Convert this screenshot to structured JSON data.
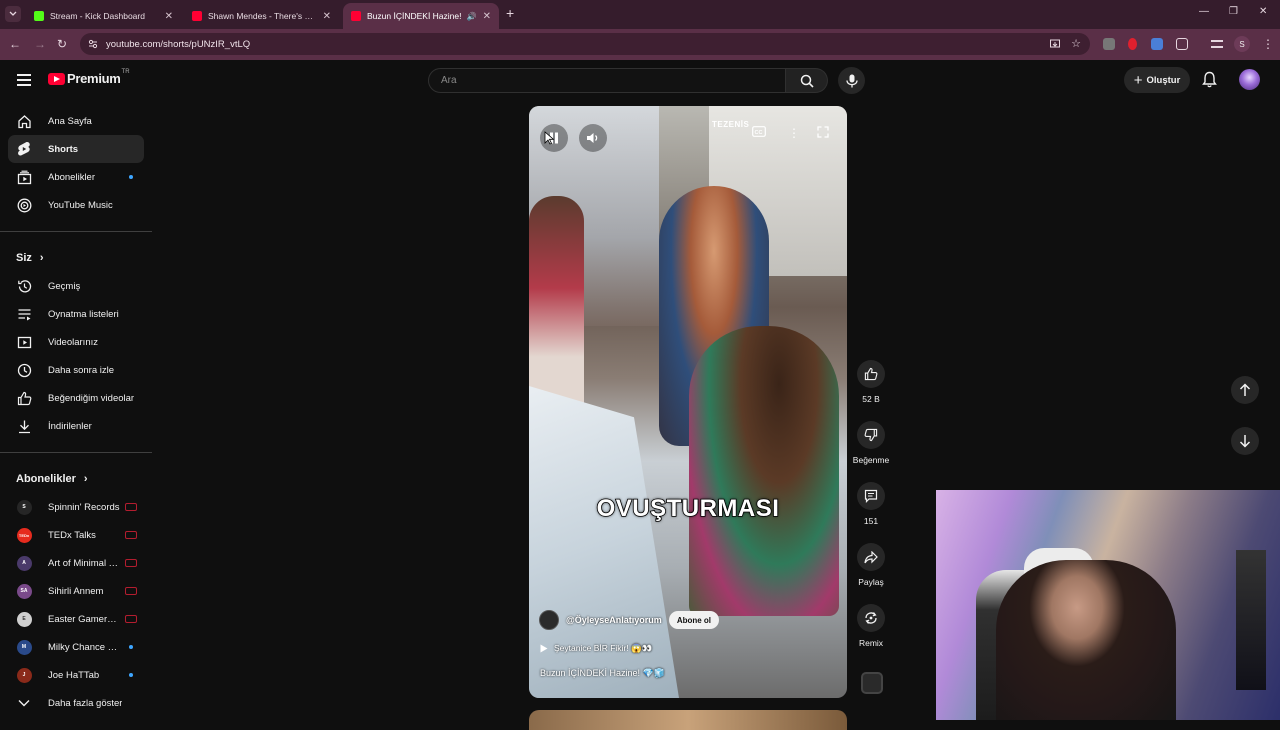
{
  "browser": {
    "tabs": [
      {
        "title": "Stream - Kick Dashboard",
        "favicon_color": "#53fc18",
        "active": false
      },
      {
        "title": "Shawn Mendes - There's Nothing",
        "favicon_color": "#ff0033",
        "active": false
      },
      {
        "title": "Buzun İÇİNDEKİ Hazine!",
        "favicon_color": "#ff0033",
        "active": true
      }
    ],
    "url": "youtube.com/shorts/pUNzIR_vtLQ",
    "profile_initial": "S"
  },
  "header": {
    "brand": "Premium",
    "country": "TR",
    "search_placeholder": "Ara",
    "create_label": "Oluştur"
  },
  "sidebar": {
    "main": [
      {
        "label": "Ana Sayfa",
        "icon": "home-icon"
      },
      {
        "label": "Shorts",
        "icon": "shorts-icon",
        "active": true
      },
      {
        "label": "Abonelikler",
        "icon": "subscriptions-icon",
        "dot": true
      },
      {
        "label": "YouTube Music",
        "icon": "music-icon"
      }
    ],
    "you_title": "Siz",
    "you": [
      {
        "label": "Geçmiş",
        "icon": "history-icon"
      },
      {
        "label": "Oynatma listeleri",
        "icon": "playlists-icon"
      },
      {
        "label": "Videolarınız",
        "icon": "your-videos-icon"
      },
      {
        "label": "Daha sonra izle",
        "icon": "watch-later-icon"
      },
      {
        "label": "Beğendiğim videolar",
        "icon": "liked-icon"
      },
      {
        "label": "İndirilenler",
        "icon": "download-icon"
      }
    ],
    "subs_title": "Abonelikler",
    "subs": [
      {
        "label": "Spinnin' Records",
        "status": "live",
        "color": "#262626",
        "glyph": "S"
      },
      {
        "label": "TEDx Talks",
        "status": "live",
        "color": "#e62b1e",
        "glyph": "TEDx"
      },
      {
        "label": "Art of Minimal T...",
        "status": "live",
        "color": "#4a3a6a",
        "glyph": "A"
      },
      {
        "label": "Sihirli Annem",
        "status": "live",
        "color": "#7a4a8a",
        "glyph": "SA"
      },
      {
        "label": "Easter GamersTv",
        "status": "live",
        "color": "#cfcfcf",
        "glyph": "E"
      },
      {
        "label": "Milky Chance Off...",
        "status": "dot",
        "color": "#2a4a8a",
        "glyph": "M"
      },
      {
        "label": "Joe HaTTab",
        "status": "dot",
        "color": "#8a2a1a",
        "glyph": "J"
      }
    ],
    "show_more": "Daha fazla göster"
  },
  "short": {
    "watermark": "TEZENİS",
    "caption": "OVUŞTURMASI",
    "channel_handle": "@ÖyleyseAnlatıyorum",
    "subscribe_label": "Abone ol",
    "sound": "Şeytanice BİR Fikir! 😱👀",
    "title": "Buzun İÇİNDEKİ Hazine! 💎🧊"
  },
  "actions": {
    "likes": "52 B",
    "dislike": "Beğenme",
    "comments": "151",
    "share": "Paylaş",
    "remix": "Remix"
  }
}
